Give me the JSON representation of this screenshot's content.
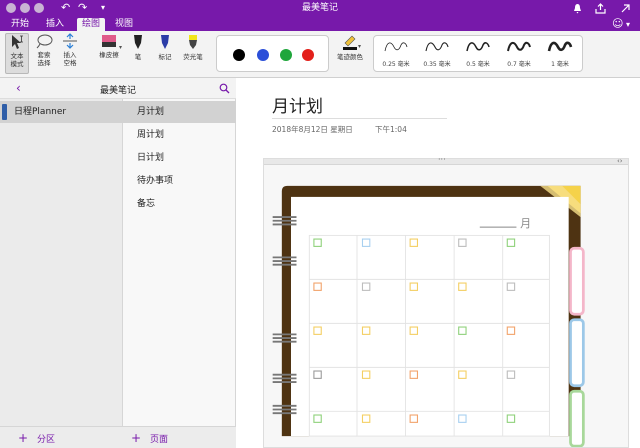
{
  "window": {
    "title": "最美笔记"
  },
  "ribbon": {
    "tabs": [
      {
        "label": "开始"
      },
      {
        "label": "插入"
      },
      {
        "label": "绘图",
        "active": true
      },
      {
        "label": "视图"
      }
    ]
  },
  "toolbar": {
    "text_mode": [
      "文本",
      "模式"
    ],
    "lasso": [
      "套索",
      "选择"
    ],
    "insert_space": [
      "插入",
      "空格"
    ],
    "eraser": "橡皮擦",
    "pen": "笔",
    "marker": "标记",
    "highlighter": "荧光笔",
    "colors": [
      "#000000",
      "#2b4fd8",
      "#1fa63b",
      "#e3201b"
    ],
    "pen_color_label": "笔迹颜色",
    "thickness": [
      "0.25 毫米",
      "0.35 毫米",
      "0.5 毫米",
      "0.7 毫米",
      "1 毫米"
    ]
  },
  "sidebar": {
    "notebook_title": "最美笔记",
    "sections": [
      {
        "label": "日程Planner",
        "color": "#2f5ea8"
      }
    ],
    "pages": [
      {
        "label": "月计划"
      },
      {
        "label": "周计划"
      },
      {
        "label": "日计划"
      },
      {
        "label": "待办事项"
      },
      {
        "label": "备忘"
      }
    ],
    "add_section": "分区",
    "add_page": "页面"
  },
  "page": {
    "title": "月计划",
    "date": "2018年8月12日 星期日",
    "time": "下午1:04",
    "planner_month_label": "_____ 月"
  },
  "colors": {
    "brand": "#7719aa",
    "planner_frame": "#4e3312",
    "planner_corner": "#f5d24a",
    "tab_pink": "#f4b6c9",
    "tab_blue": "#9cc8e8",
    "tab_green": "#a8d89a"
  }
}
